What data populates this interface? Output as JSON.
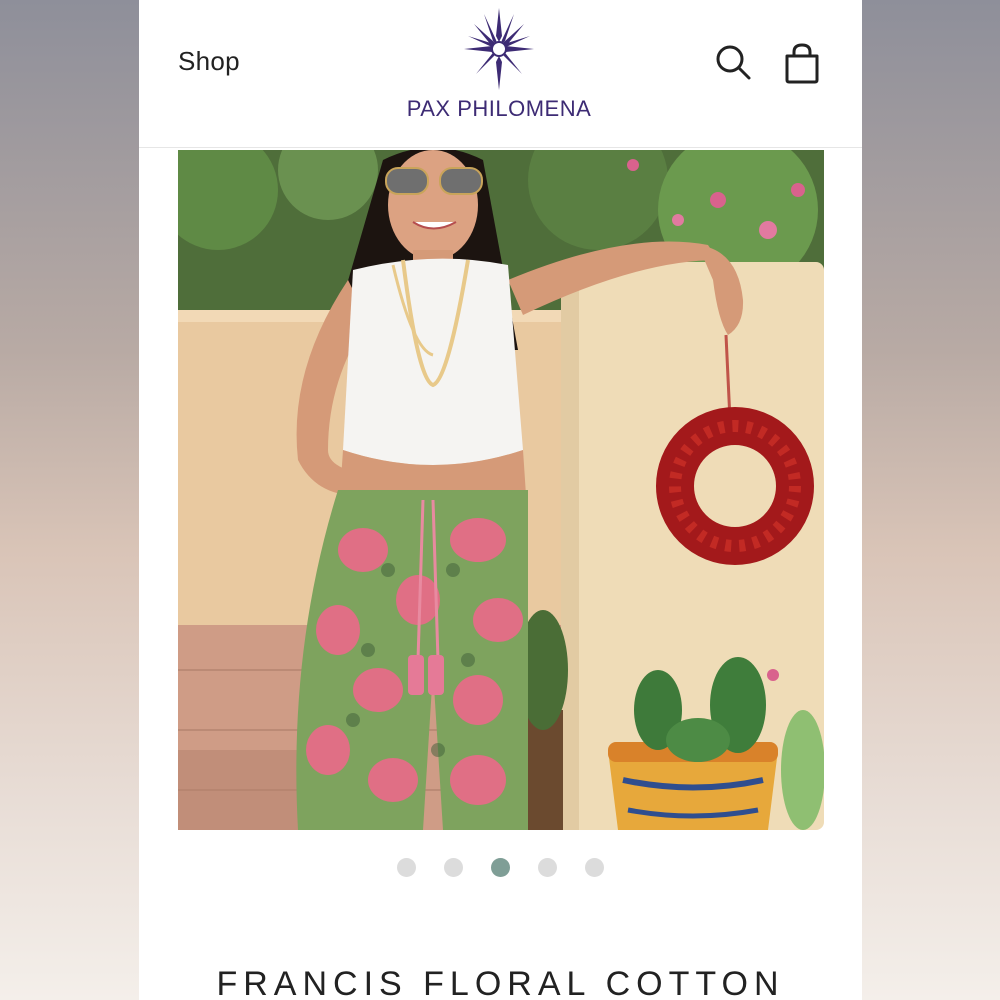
{
  "header": {
    "shop_label": "Shop",
    "brand_name": "PAX PHILOMENA",
    "icons": [
      "sun-star-logo-icon",
      "search-icon",
      "shopping-bag-icon"
    ]
  },
  "gallery": {
    "dot_count": 5,
    "active_index": 2
  },
  "product": {
    "title": "FRANCIS FLORAL COTTON"
  },
  "colors": {
    "brand": "#3d2b74",
    "active_dot": "#7f9e96",
    "inactive_dot": "#dcdcdc"
  }
}
